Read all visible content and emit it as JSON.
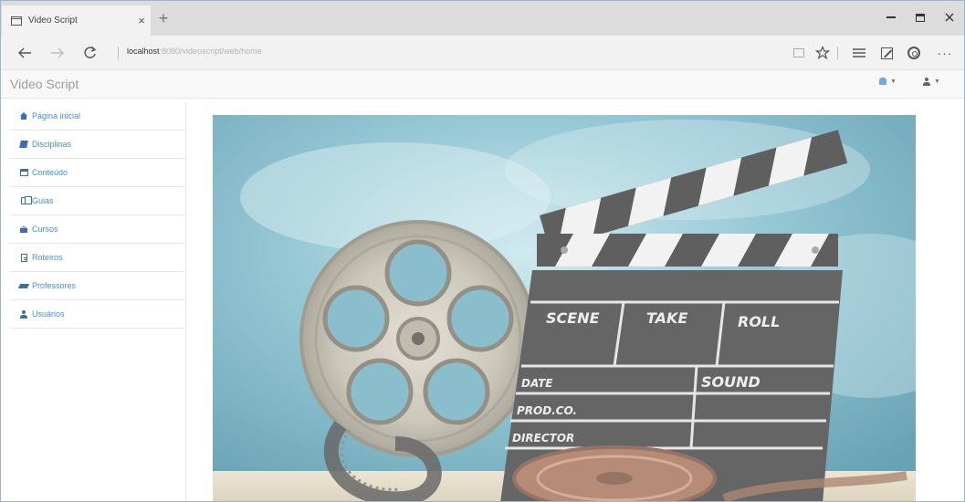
{
  "browser": {
    "tab_title": "Video Script",
    "tab_close": "×",
    "new_tab": "+",
    "address_host": "localhost",
    "address_rest": ":8080/videoscript/web/home",
    "more_glyph": "···"
  },
  "app": {
    "brand": "Video Script"
  },
  "sidebar": {
    "items": [
      {
        "label": "Página inicial",
        "icon": "home-icon"
      },
      {
        "label": "Disciplinas",
        "icon": "book-icon"
      },
      {
        "label": "Conteúdo",
        "icon": "calendar-icon"
      },
      {
        "label": "Guias",
        "icon": "copy-icon"
      },
      {
        "label": "Cursos",
        "icon": "lock-icon"
      },
      {
        "label": "Roteiros",
        "icon": "document-icon"
      },
      {
        "label": "Professores",
        "icon": "graduation-cap-icon"
      },
      {
        "label": "Usuários",
        "icon": "user-icon"
      }
    ]
  },
  "hero": {
    "clapper_labels": [
      "SCENE",
      "TAKE",
      "ROLL",
      "DATE",
      "SOUND",
      "PROD.CO.",
      "DIRECTOR"
    ]
  },
  "colors": {
    "link": "#4a8bd1",
    "brand": "#9d9d9d",
    "sky": "#4f9bb4"
  }
}
